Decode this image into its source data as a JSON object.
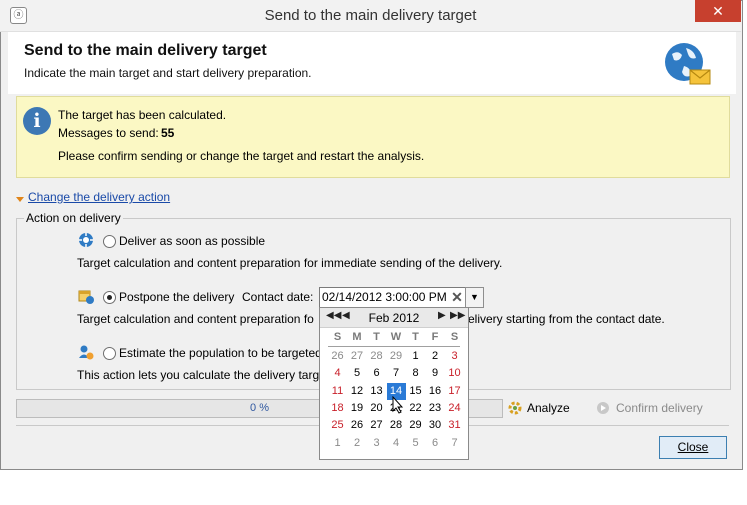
{
  "window": {
    "title": "Send to the main delivery target",
    "close_glyph": "✕"
  },
  "header": {
    "title": "Send to the main delivery target",
    "subtitle": "Indicate the main target and start delivery preparation."
  },
  "info": {
    "line1": "The target has been calculated.",
    "messages_label": "Messages to send:",
    "messages_count": "55",
    "line3": "Please confirm sending or change the target and restart the analysis."
  },
  "change_action": {
    "label": "Change the delivery action"
  },
  "action_group": {
    "legend": "Action on delivery",
    "options": [
      {
        "label": "Deliver as soon as possible",
        "desc": "Target calculation and content preparation for immediate sending of the delivery.",
        "checked": false
      },
      {
        "label": "Postpone the delivery",
        "desc_prefix": "Target calculation and content preparation fo",
        "desc_suffix": "elivery starting from the contact date.",
        "checked": true
      },
      {
        "label": "Estimate the population to be targeted",
        "desc": "This action lets you calculate the delivery targe",
        "checked": false
      }
    ],
    "contact_label": "Contact date:",
    "contact_value": "02/14/2012 3:00:00 PM"
  },
  "calendar": {
    "month_label": "Feb 2012",
    "weekdays": [
      "S",
      "M",
      "T",
      "W",
      "T",
      "F",
      "S"
    ],
    "weeks": [
      [
        "26",
        "27",
        "28",
        "29",
        "1",
        "2",
        "3"
      ],
      [
        "4",
        "5",
        "6",
        "7",
        "8",
        "9",
        "10"
      ],
      [
        "11",
        "12",
        "13",
        "14",
        "15",
        "16",
        "17"
      ],
      [
        "18",
        "19",
        "20",
        "21",
        "22",
        "23",
        "24"
      ],
      [
        "25",
        "26",
        "27",
        "28",
        "29",
        "30",
        "31"
      ],
      [
        "1",
        "2",
        "3",
        "4",
        "5",
        "6",
        "7"
      ]
    ],
    "selected": "14"
  },
  "progress": {
    "text": "0 %",
    "value": 0
  },
  "buttons": {
    "analyze": "Analyze",
    "confirm": "Confirm delivery",
    "close": "Close"
  }
}
